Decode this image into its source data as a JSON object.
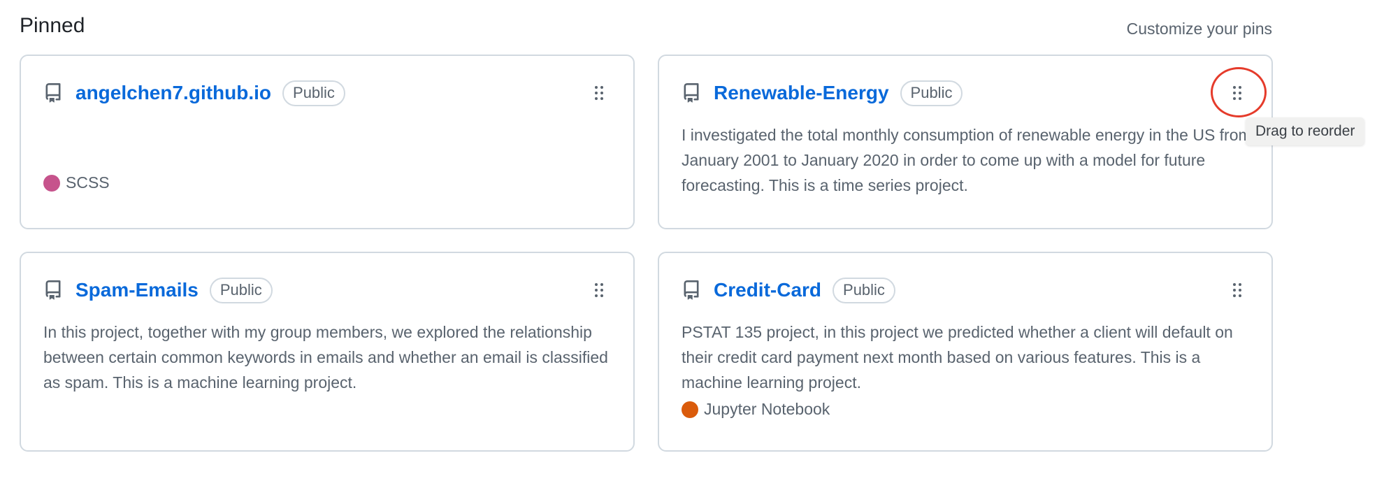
{
  "section": {
    "title": "Pinned",
    "customize_label": "Customize your pins"
  },
  "cards": [
    {
      "name": "angelchen7.github.io",
      "visibility": "Public",
      "description": "",
      "language": "SCSS",
      "language_color": "#c6538c",
      "icon": "repo-icon",
      "drag_icon": "drag-handle-icon"
    },
    {
      "name": "Renewable-Energy",
      "visibility": "Public",
      "description": "I investigated the total monthly consumption of renewable energy in the US from January 2001 to January 2020 in order to come up with a model for future forecasting. This is a time series project.",
      "language": "",
      "language_color": "",
      "icon": "repo-icon",
      "drag_icon": "drag-handle-icon"
    },
    {
      "name": "Spam-Emails",
      "visibility": "Public",
      "description": "In this project, together with my group members, we explored the relationship between certain common keywords in emails and whether an email is classified as spam. This is a machine learning project.",
      "language": "",
      "language_color": "",
      "icon": "repo-icon",
      "drag_icon": "drag-handle-icon"
    },
    {
      "name": "Credit-Card",
      "visibility": "Public",
      "description": "PSTAT 135 project, in this project we predicted whether a client will default on their credit card payment next month based on various features. This is a machine learning project.",
      "language": "Jupyter Notebook",
      "language_color": "#da5b0b",
      "icon": "repo-icon",
      "drag_icon": "drag-handle-icon"
    }
  ],
  "tooltip": {
    "text": "Drag to reorder"
  },
  "colors": {
    "link": "#0969da",
    "muted_text": "#59636e",
    "border": "#d1d9e0",
    "highlight": "#e53b2b"
  }
}
